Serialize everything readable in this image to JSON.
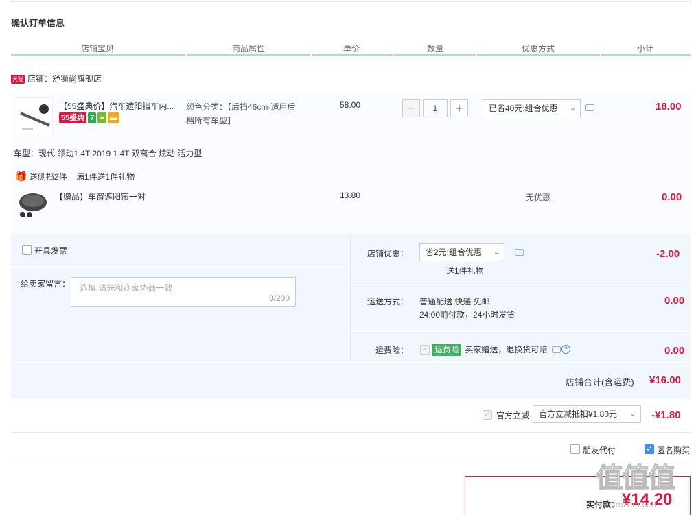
{
  "page": {
    "title": "确认订单信息"
  },
  "table_headers": [
    "店铺宝贝",
    "商品属性",
    "单价",
    "数量",
    "优惠方式",
    "小计"
  ],
  "shop": {
    "badge": "天猫",
    "label": "店铺：",
    "name": "舒狮尚旗舰店"
  },
  "item": {
    "title": "【55盛典价】汽车遮阳挡车内...",
    "badge_55": "55盛典",
    "badge_7": "7",
    "attr_line1": "颜色分类：【后挡46cm-适用后",
    "attr_line2": "档所有车型】",
    "unit_price": "58.00",
    "quantity": "1",
    "discount": "已省40元:组合优惠",
    "subtotal": "18.00",
    "car_model": "车型：现代 领动1.4T 2019 1.4T 双离合 炫动.活力型"
  },
  "gift": {
    "promo_text": "送侧挡2件",
    "promo_rule": "满1件送1件礼物",
    "title": "【赠品】车窗遮阳帘一对",
    "unit_price": "13.80",
    "discount": "无优惠",
    "subtotal": "0.00"
  },
  "invoice": {
    "label": "开具发票"
  },
  "message": {
    "label": "给卖家留言：",
    "placeholder": "选填,请先和商家协商一致",
    "counter": "0/200"
  },
  "shop_discount": {
    "label": "店铺优惠：",
    "value": "省2元:组合优惠",
    "note": "送1件礼物",
    "amount": "-2.00"
  },
  "shipping": {
    "label": "运送方式：",
    "line1": "普通配送 快递 免邮",
    "line2": "24:00前付款，24小时发货",
    "amount": "0.00"
  },
  "insurance": {
    "label": "运费险：",
    "tag": "运费险",
    "text": "卖家赠送，退换货可赔",
    "amount": "0.00"
  },
  "shop_total": {
    "label": "店铺合计(含运费)",
    "amount": "¥16.00"
  },
  "official": {
    "label": "官方立减",
    "value": "官方立减抵扣¥1.80元",
    "amount": "-¥1.80"
  },
  "options": {
    "friend_pay": "朋友代付",
    "anonymous": "匿名购买"
  },
  "pay": {
    "label": "实付款：",
    "amount": "¥14.20"
  },
  "watermark": {
    "text": "值值值",
    "site": "smzdm.com"
  },
  "colors": {
    "accent": "#e4143c",
    "header_line": "#b2d1ff",
    "footer_bg": "#f2f7ff",
    "checkbox": "#3c8ee8"
  },
  "icons": [
    "chevron-down-icon",
    "message-icon",
    "gift-icon",
    "question-icon",
    "check-icon"
  ]
}
